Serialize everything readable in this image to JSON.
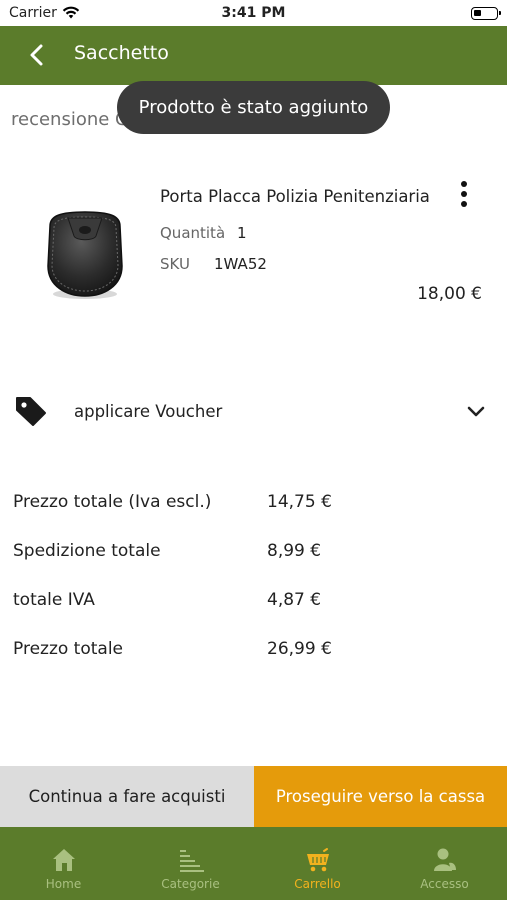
{
  "status_bar": {
    "carrier": "Carrier",
    "time": "3:41 PM"
  },
  "header": {
    "title": "Sacchetto"
  },
  "toast": {
    "message": "Prodotto è stato aggiunto"
  },
  "review_label": "recensione Checkout",
  "cart_item": {
    "name": "Porta Placca Polizia Penitenziaria",
    "quantity_label": "Quantità",
    "quantity": "1",
    "sku_label": "SKU",
    "sku": "1WA52",
    "price": "18,00 €"
  },
  "voucher": {
    "label": "applicare Voucher"
  },
  "totals": [
    {
      "label": "Prezzo totale (Iva escl.)",
      "value": "14,75 €"
    },
    {
      "label": "Spedizione totale",
      "value": "8,99 €"
    },
    {
      "label": "totale IVA",
      "value": "4,87 €"
    },
    {
      "label": "Prezzo totale",
      "value": "26,99 €"
    }
  ],
  "actions": {
    "continue_label": "Continua a fare acquisti",
    "checkout_label": "Proseguire verso la cassa"
  },
  "tabs": [
    {
      "label": "Home",
      "icon": "home-icon",
      "active": false
    },
    {
      "label": "Categorie",
      "icon": "categories-icon",
      "active": false
    },
    {
      "label": "Carrello",
      "icon": "cart-icon",
      "active": true
    },
    {
      "label": "Accesso",
      "icon": "user-icon",
      "active": false
    }
  ],
  "colors": {
    "brand_green": "#5b7c2b",
    "accent_orange": "#e59b0b",
    "toast_bg": "#3b3b3b",
    "tab_inactive": "#a9c080",
    "tab_active": "#f3b21e"
  }
}
